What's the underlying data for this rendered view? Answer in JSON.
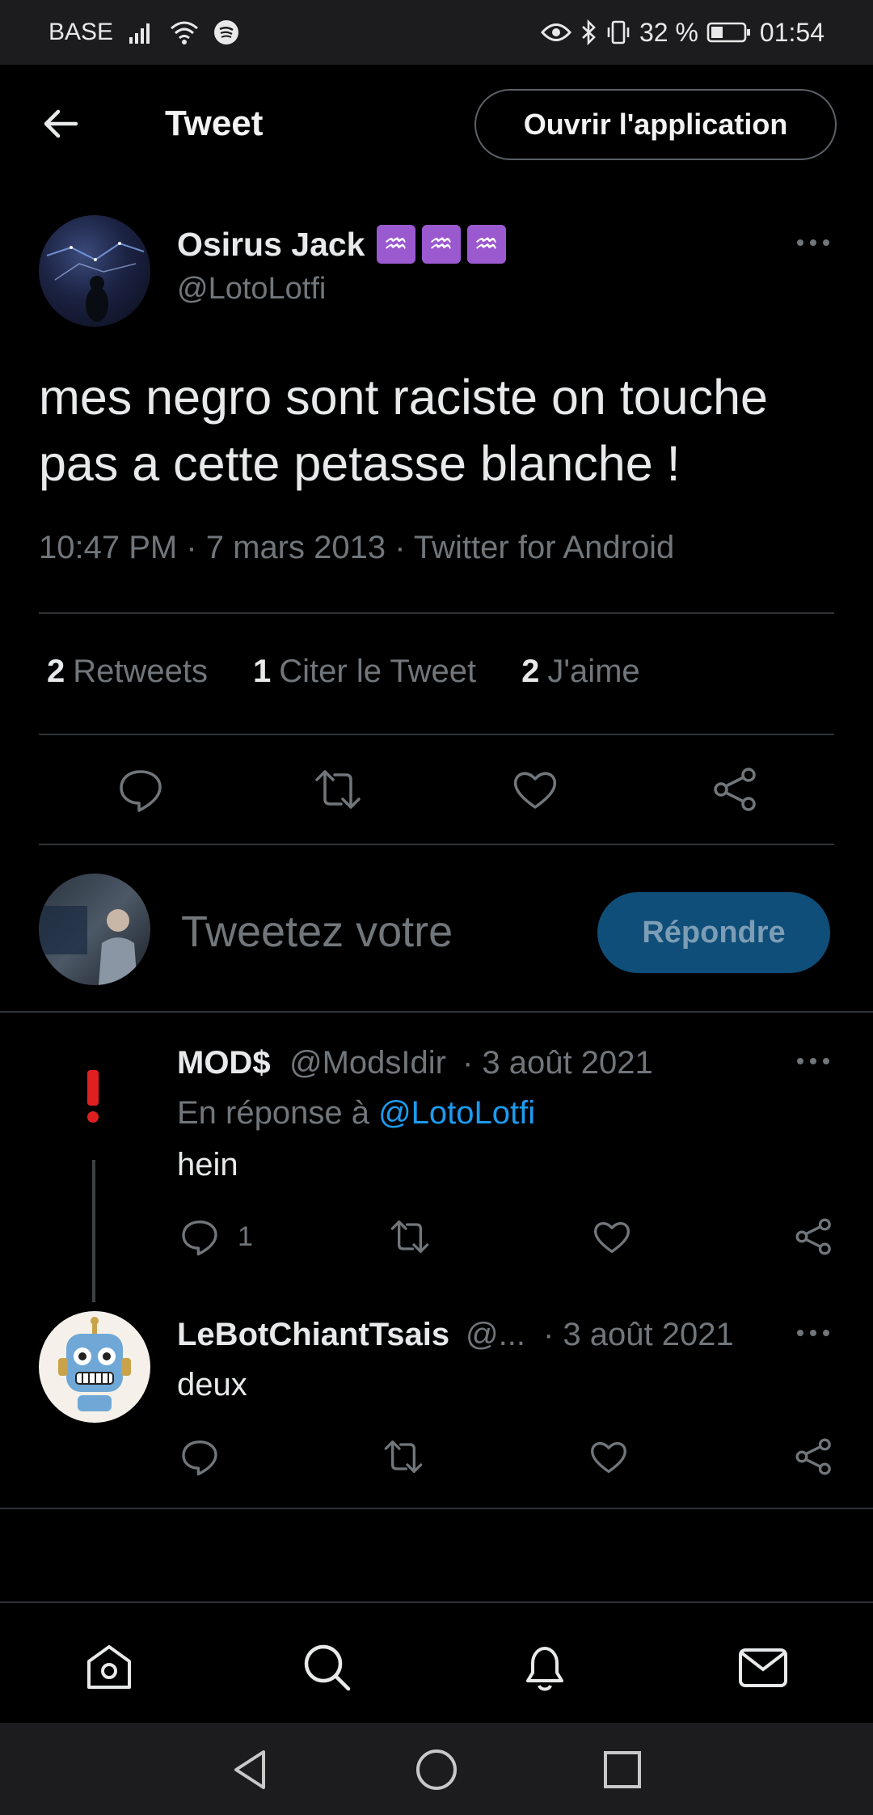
{
  "status_bar": {
    "carrier": "BASE",
    "battery": "32 %",
    "time": "01:54"
  },
  "header": {
    "title": "Tweet",
    "open_app": "Ouvrir l'application"
  },
  "tweet": {
    "author_name": "Osirus Jack",
    "zodiac_icons": [
      "♒",
      "♒",
      "♒"
    ],
    "handle": "@LotoLotfi",
    "text": "mes negro sont raciste on touche pas a cette petasse blanche !",
    "meta": "10:47 PM · 7 mars 2013 · Twitter for Android",
    "retweets_count": "2",
    "retweets_label": "Retweets",
    "quotes_count": "1",
    "quotes_label": "Citer le Tweet",
    "likes_count": "2",
    "likes_label": "J'aime"
  },
  "compose": {
    "placeholder": "Tweetez votre",
    "reply_button": "Répondre"
  },
  "replies": [
    {
      "name": "MOD$",
      "handle": "@ModsIdir",
      "date": "· 3 août 2021",
      "in_reply_prefix": "En réponse à",
      "in_reply_to": "@LotoLotfi",
      "text": "hein",
      "reply_count": "1"
    },
    {
      "name": "LeBotChiantTsais",
      "handle": "@...",
      "date": "· 3 août 2021",
      "text": "deux"
    }
  ],
  "colors": {
    "background": "#000000",
    "accent": "#1d9bf0",
    "reply_button": "#0f4e78",
    "muted_text": "#71767b"
  }
}
